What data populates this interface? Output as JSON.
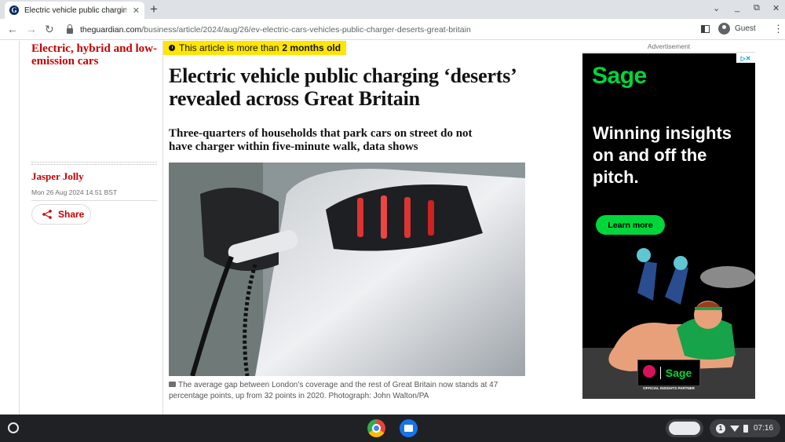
{
  "browser": {
    "tab_title": "Electric vehicle public charging 'deserts' revealed",
    "favicon_letter": "G",
    "close_glyph": "✕",
    "new_tab_glyph": "+",
    "url_host": "theguardian.com",
    "url_path": "/business/article/2024/aug/26/ev-electric-cars-vehicles-public-charger-deserts-great-britain",
    "profile_label": "Guest",
    "back_glyph": "←",
    "forward_glyph": "→",
    "reload_glyph": "↻",
    "menu_glyph": "⋮",
    "tabsearch_glyph": "⌄",
    "minimize_glyph": "_",
    "restore_glyph": "⧉",
    "window_close_glyph": "✕"
  },
  "article": {
    "section": "Electric, hybrid and low-emission cars",
    "age_notice_prefix": "This article is more than",
    "age_notice_emphasis": "2 months old",
    "headline": "Electric vehicle public charging ‘deserts’ revealed across Great Britain",
    "standfirst": "Three-quarters of households that park cars on street do not have charger within five-minute walk, data shows",
    "author": "Jasper Jolly",
    "dateline": "Mon 26 Aug 2024 14.51 BST",
    "share_label": "Share",
    "caption": "The average gap between London’s coverage and the rest of Great Britain now stands at 47 percentage points, up from 32 points in 2020. Photograph: John Walton/PA"
  },
  "ad": {
    "label": "Advertisement",
    "brand": "Sage",
    "headline": "Winning insights on and off the pitch.",
    "cta": "Learn more",
    "partner_brand": "Sage",
    "partner_text": "OFFICIAL INSIGHTS PARTNER",
    "choices_glyphs": "▷✕",
    "brand_color": "#00d639"
  },
  "shelf": {
    "notification_count": "1",
    "time": "07:16"
  },
  "colors": {
    "guardian_red": "#c70000",
    "age_banner_yellow": "#ffe500",
    "sage_green": "#00d639"
  }
}
